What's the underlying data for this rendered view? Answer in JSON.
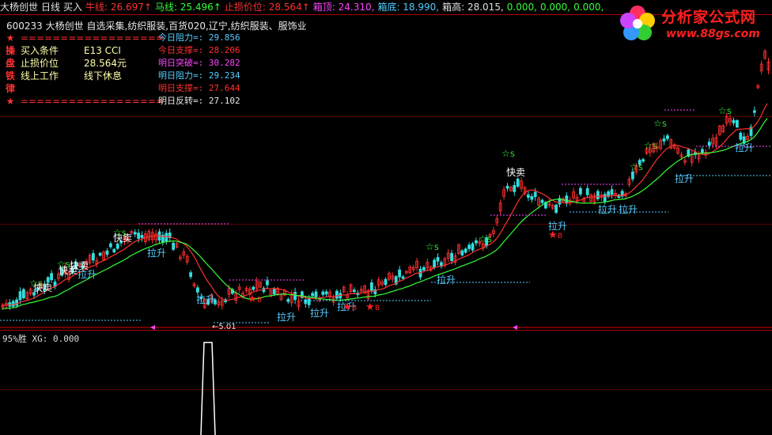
{
  "topbar": {
    "items": [
      {
        "text": "大杨创世",
        "color": "#e0e0e0"
      },
      {
        "text": "日线",
        "color": "#e0e0e0"
      },
      {
        "text": "买入",
        "color": "#e0e0e0"
      },
      {
        "text": "牛线: 26.697↑",
        "color": "#ff3030"
      },
      {
        "text": "马线: 25.496↑",
        "color": "#33ff33"
      },
      {
        "text": "止损价位: 28.564↑",
        "color": "#ff3030"
      },
      {
        "text": "箱顶: 24.310,",
        "color": "#ff44ff"
      },
      {
        "text": "箱底: 18.990,",
        "color": "#55ccff"
      },
      {
        "text": "箱高: 28.015,",
        "color": "#e0e0e0"
      },
      {
        "text": "0.000,",
        "color": "#33ff33"
      },
      {
        "text": "0.000,",
        "color": "#33ff33"
      },
      {
        "text": "0.000,",
        "color": "#33ff33"
      }
    ]
  },
  "stock": {
    "code": "600233",
    "name": "大杨创世",
    "sectors": "自选采集,纺织服装,百货020,辽宁,纺织服装、服饰业"
  },
  "rules": {
    "side_chars": [
      "★",
      "操",
      "盘",
      "铁",
      "律",
      "★"
    ],
    "rows": [
      {
        "a": "==================",
        "b": ""
      },
      {
        "a": "买入条件",
        "b": "E13 CCI"
      },
      {
        "a": "止损价位",
        "b": "28.564元"
      },
      {
        "a": "线上工作",
        "b": "线下休息"
      },
      {
        "a": "",
        "b": ""
      },
      {
        "a": "==================",
        "b": ""
      }
    ]
  },
  "levels": [
    {
      "label": "今日阻力=: 29.856",
      "color": "#55ccff"
    },
    {
      "label": "今日支撑=: 28.206",
      "color": "#ff3030"
    },
    {
      "label": "明日突破=: 30.282",
      "color": "#ff44ff"
    },
    {
      "label": "明日阻力=: 29.234",
      "color": "#55ccff"
    },
    {
      "label": "明日支撑=: 27.644",
      "color": "#ff3030"
    },
    {
      "label": "明日反转=: 27.102",
      "color": "#e8e8e8"
    }
  ],
  "logo": {
    "title": "分析家公式网",
    "url": "www.88gs.com"
  },
  "annotations": {
    "kuai": "快卖",
    "la": "拉升",
    "buy": "B",
    "sell": "S",
    "low": "←5.01"
  },
  "indicator": {
    "label": "95%胜 XG: 0.000"
  },
  "colors": {
    "up": "#ff3030",
    "down": "#33dddd",
    "bull_line": "#ff3030",
    "horse_line": "#33ff33",
    "box_top": "#ff44ff",
    "box_bottom": "#55ccff",
    "frame": "#aa0000"
  }
}
